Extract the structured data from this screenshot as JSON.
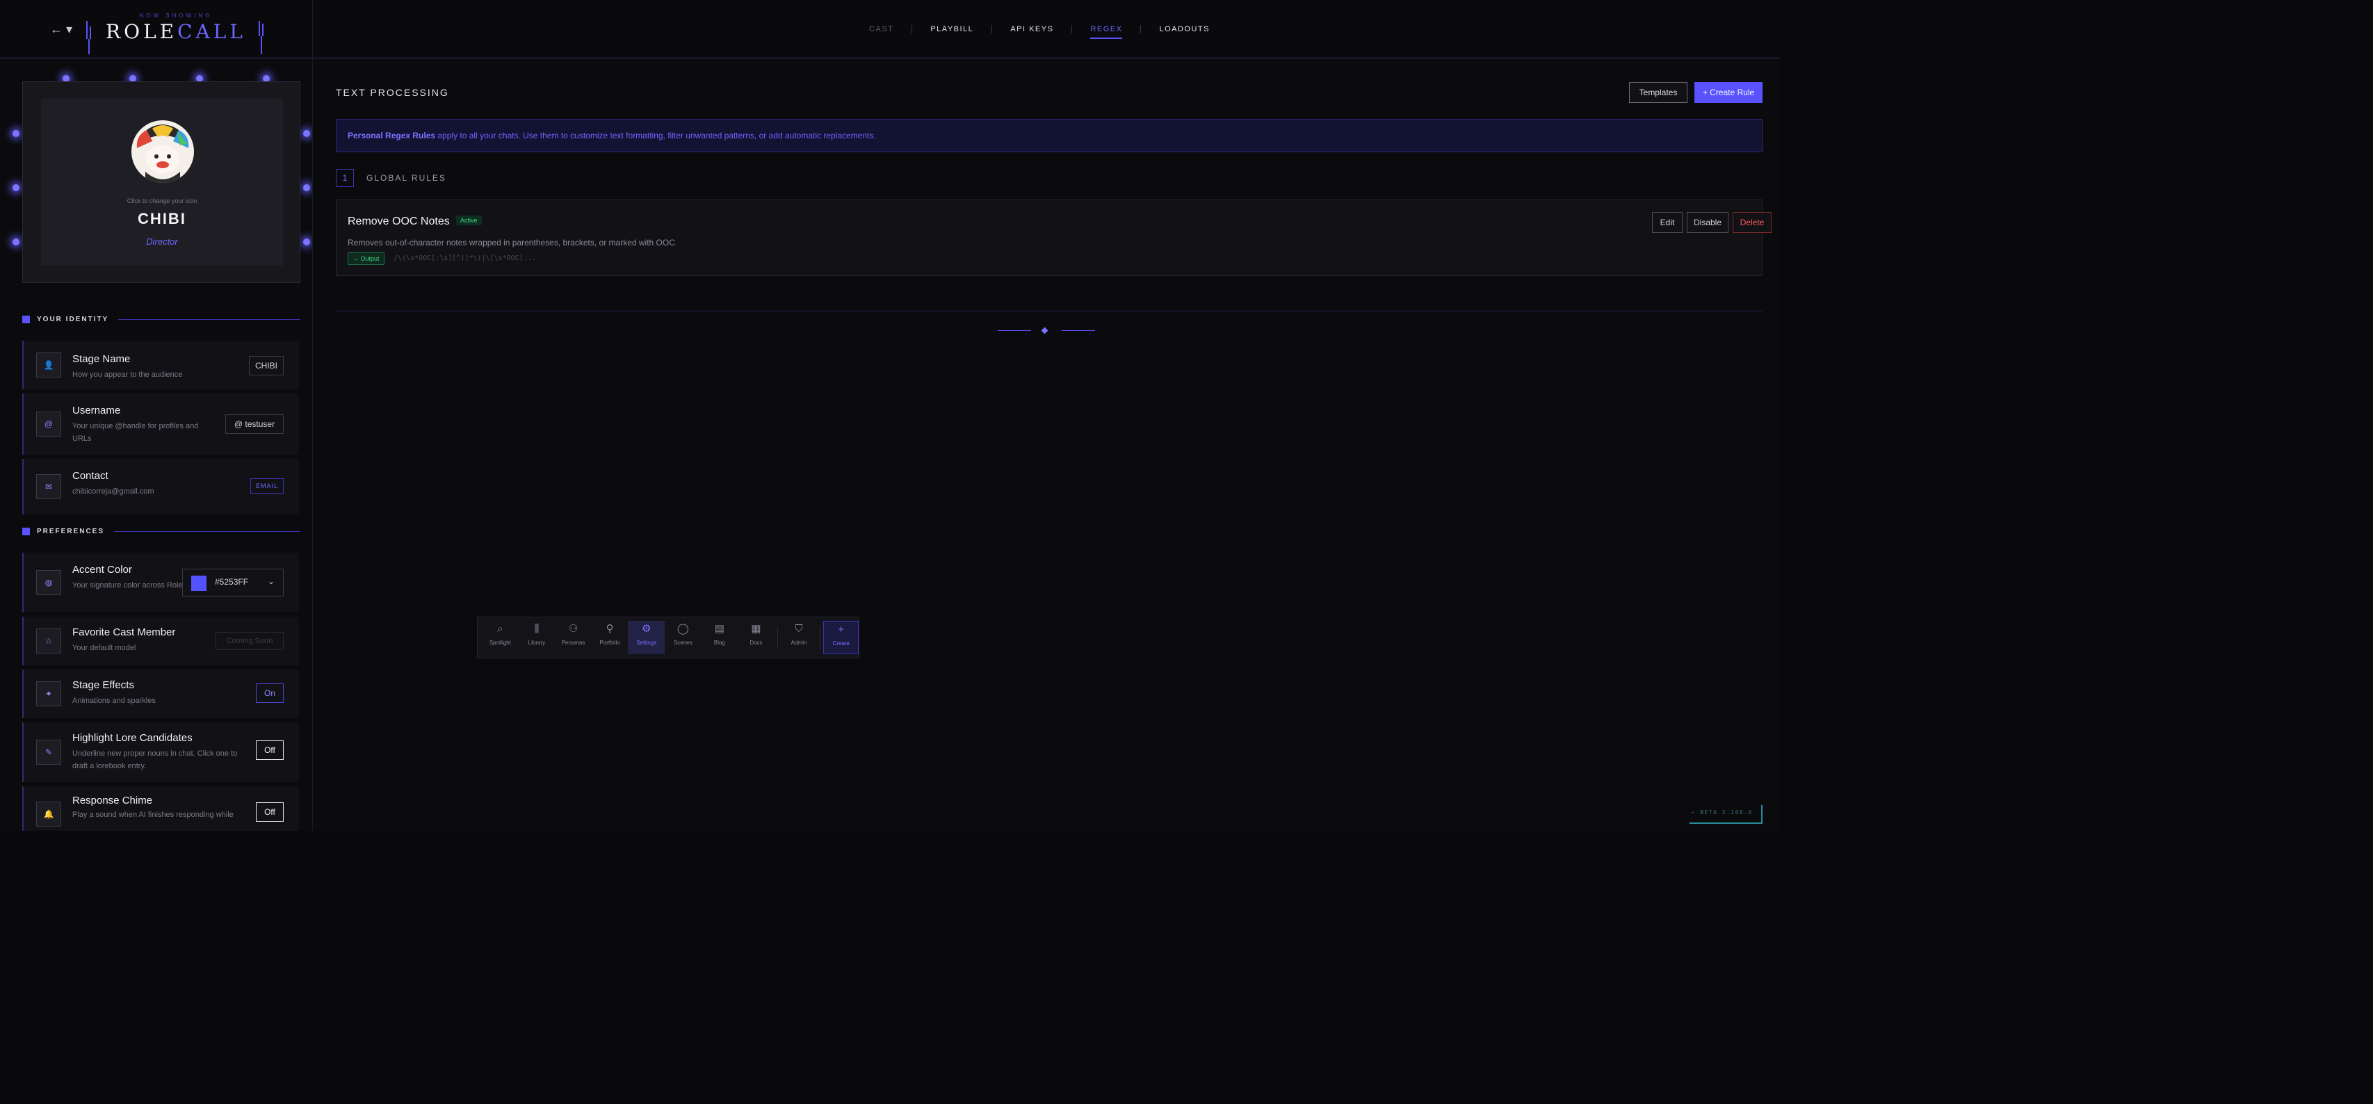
{
  "header": {
    "kicker": "NOW SHOWING",
    "logo_main": "ROLE",
    "logo_accent": "CALL",
    "back_icon": "arrow-left-icon",
    "nav": [
      {
        "label": "CAST"
      },
      {
        "label": "PLAYBILL"
      },
      {
        "label": "API KEYS"
      },
      {
        "label": "REGEX"
      },
      {
        "label": "LOADOUTS"
      }
    ]
  },
  "profile": {
    "change_icon_hint": "Click to change your icon",
    "name": "CHIBI",
    "role": "Director"
  },
  "identity": {
    "section_title": "YOUR IDENTITY",
    "stage_name": {
      "title": "Stage Name",
      "desc": "How you appear to the audience",
      "value": "CHIBI",
      "icon": "user-icon"
    },
    "username": {
      "title": "Username",
      "desc": "Your unique @handle for profiles and URLs",
      "value": "@ testuser",
      "icon": "at-icon"
    },
    "contact": {
      "title": "Contact",
      "desc": "chibicorreja@gmail.com",
      "badge": "EMAIL",
      "icon": "mail-icon"
    }
  },
  "preferences": {
    "section_title": "PREFERENCES",
    "accent_color": {
      "title": "Accent Color",
      "desc": "Your signature color across RoleCall",
      "value": "#5253FF",
      "icon": "palette-icon"
    },
    "favorite_cast": {
      "title": "Favorite Cast Member",
      "desc": "Your default model",
      "value": "Coming Soon",
      "icon": "star-icon"
    },
    "stage_effects": {
      "title": "Stage Effects",
      "desc": "Animations and sparkles",
      "value": "On",
      "icon": "sparkle-icon"
    },
    "highlight_lore": {
      "title": "Highlight Lore Candidates",
      "desc": "Underline new proper nouns in chat. Click one to draft a lorebook entry.",
      "value": "Off",
      "icon": "highlighter-icon"
    },
    "response_chime": {
      "title": "Response Chime",
      "desc": "Play a sound when AI finishes responding while",
      "value": "Off",
      "icon": "bell-icon"
    }
  },
  "main": {
    "title": "TEXT PROCESSING",
    "templates_label": "Templates",
    "create_label": "+ Create Rule",
    "banner_bold": "Personal Regex Rules",
    "banner_rest": " apply to all your chats. Use them to customize text formatting, filter unwanted patterns, or add automatic replacements.",
    "group_count": "1",
    "group_label": "GLOBAL RULES",
    "rule": {
      "title": "Remove OOC Notes",
      "status": "Active",
      "description": "Removes out-of-character notes wrapped in parentheses, brackets, or marked with OOC",
      "tag": "→ Output",
      "pattern": "/\\(\\s*OOC[:\\s][^)]*\\)|\\[\\s*OOC[...",
      "edit_label": "Edit",
      "disable_label": "Disable",
      "delete_label": "Delete"
    }
  },
  "version": "← BETA 2.108.6",
  "dock": [
    {
      "label": "Spotlight",
      "icon": "search-icon"
    },
    {
      "label": "Library",
      "icon": "library-icon"
    },
    {
      "label": "Personas",
      "icon": "users-icon"
    },
    {
      "label": "Portfolio",
      "icon": "person-icon"
    },
    {
      "label": "Settings",
      "icon": "gear-icon"
    },
    {
      "label": "Scenes",
      "icon": "chat-bubble-icon"
    },
    {
      "label": "Blog",
      "icon": "newspaper-icon"
    },
    {
      "label": "Docs",
      "icon": "document-icon"
    },
    {
      "label": "Admin",
      "icon": "shield-icon"
    },
    {
      "label": "Create",
      "icon": "plus-icon"
    }
  ],
  "colors": {
    "accent": "#5A52FF",
    "active_status": "#3FCF83",
    "delete": "#FF5C5C"
  }
}
